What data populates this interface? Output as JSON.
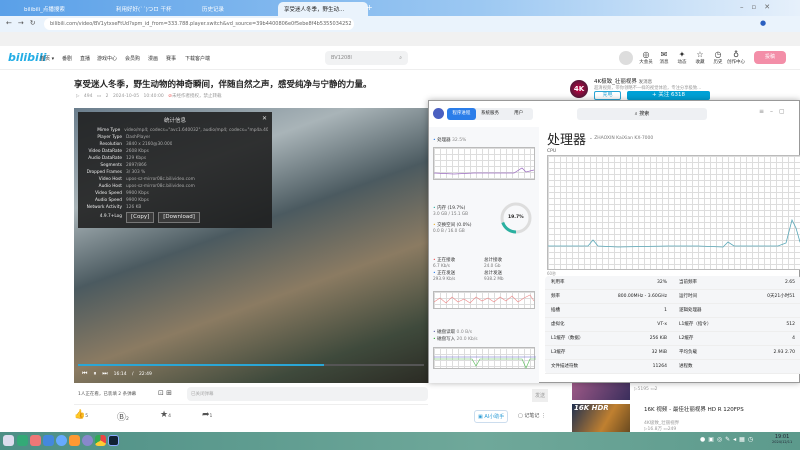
{
  "browser": {
    "tabs": [
      "bilibili_点播搜索",
      "利用好好(`´)つロ 干杯",
      "历史记录",
      "享受迷人冬季，野生动..."
    ],
    "url": "bilibili.com/video/BV1ytxseFtUd?spm_id_from=333.788.player.switch&vd_source=39b4400806e0f5ebe8f4b5355034252"
  },
  "header": {
    "logo": "bilibili",
    "nav": [
      "首页 ▾",
      "番剧",
      "直播",
      "游戏中心",
      "会员购",
      "漫画",
      "赛事",
      "下载客户端"
    ],
    "search_placeholder": "BV1208I",
    "icons": [
      {
        "label": "大会员",
        "icon": "vip-icon"
      },
      {
        "label": "消息",
        "icon": "message-icon",
        "badge": "1"
      },
      {
        "label": "动态",
        "icon": "dynamic-icon"
      },
      {
        "label": "收藏",
        "icon": "star-icon"
      },
      {
        "label": "历史",
        "icon": "clock-icon"
      },
      {
        "label": "创作中心",
        "icon": "bulb-icon"
      }
    ],
    "upload": "投稿"
  },
  "video": {
    "title": "享受迷人冬季，野生动物的神奇瞬间，伴随自然之声，感受纯净与宁静的力量。",
    "views": "494",
    "danmaku": "2",
    "date": "2024-10-05 10:40:00",
    "copyright": "未经作者授权，禁止转载",
    "time": "16:14 / 22:49",
    "progress": 0.71,
    "viewers": "1人正在看，已装填 2 条弹幕",
    "danmaku_placeholder": "已关闭弹幕",
    "send": "发送"
  },
  "stats_panel": {
    "title": "统计信息",
    "rows": [
      [
        "Mime Type",
        "video/mp4; codecs=\"avc1.640032\", audio/mp4; codecs=\"mp4a.40.2\""
      ],
      [
        "Player Type",
        "DashPlayer"
      ],
      [
        "Resolution",
        "3840 x 2160@30.000"
      ],
      [
        "Video DataRate",
        "2608 Kbps"
      ],
      [
        "Audio DataRate",
        "129 Kbps"
      ],
      [
        "Segments",
        "2897/866"
      ],
      [
        "Dropped Frames",
        "3/ 303 %"
      ],
      [
        "Video Host",
        "upos-sz-mirror08c.bilivideo.com"
      ],
      [
        "Audio Host",
        "upos-sz-mirror08c.bilivideo.com"
      ],
      [
        "Video Speed",
        "9900 Kbps"
      ],
      [
        "Audio Speed",
        "9900 Kbps"
      ],
      [
        "Network Activity",
        "126 KB"
      ]
    ],
    "log_label": "4.9.7+Log",
    "copy": "[Copy]",
    "download": "[Download]"
  },
  "actions": {
    "like": "5",
    "coin": "2",
    "fav": "4",
    "share": "1",
    "ai": "AI小助手",
    "notes": "记笔记"
  },
  "uploader": {
    "name": "4K极致_壮丽视界",
    "msg": "发消息",
    "desc": "超清视频，带你领略不一样的视觉体验，专注分享极致...",
    "charge": "充电",
    "follow": "+ 关注 6318"
  },
  "recs": [
    {
      "views": "5195",
      "dm": "2"
    },
    {
      "title": "16K 视频 - 最佳壮丽视界 HD R 120FPS",
      "author": "4K极致_壮丽视界",
      "views": "16.8万",
      "dm": "249"
    }
  ],
  "taskmgr": {
    "tabs": [
      "程序进程",
      "系统服务",
      "用户"
    ],
    "search": "搜索",
    "title": "处理器",
    "model": "ZHAOXIN KaiXian KX-7000",
    "graph_label": "CPU",
    "graph_axis": "60秒",
    "cpu": {
      "label": "处理器",
      "value": "32.5%"
    },
    "mem": {
      "label": "内存 (19.7%)",
      "value": "3.0 GB / 15.1 GB",
      "swap_label": "交换空间 (0.0%)",
      "swap_value": "0.0 B / 16.0 GB",
      "ring": "19.7%",
      "fraction": 0.197
    },
    "net": {
      "recv": "正在接收",
      "recv_v": "6.7 Kb/s",
      "total_recv": "总计接收",
      "total_recv_v": "24.0 Gb",
      "send": "正在发送",
      "send_v": "293.9 Kb/s",
      "total_send": "总计发送",
      "total_send_v": "938.2 Mb"
    },
    "disk": {
      "read": "磁盘读取",
      "read_v": "0.0 B/s",
      "write": "磁盘写入",
      "write_v": "20.0 Kb/s"
    },
    "rows": [
      [
        "利用率",
        "32%",
        "当前频率",
        "2.65"
      ],
      [
        "频率",
        "800.00MHz - 3.60GHz",
        "运行时间",
        "0天21小时51"
      ],
      [
        "插槽",
        "1",
        "逻辑处理器",
        ""
      ],
      [
        "虚拟化",
        "VT-x",
        "L1缓存（指令）",
        "512"
      ],
      [
        "L1缓存（数据）",
        "256 KiB",
        "L2缓存",
        "4"
      ],
      [
        "L3缓存",
        "32 MiB",
        "平均负载",
        "2.93 2.70"
      ],
      [
        "文件描述符数",
        "11264",
        "进程数",
        ""
      ]
    ]
  },
  "clock": {
    "time": "19:01",
    "date": "2024/12/11"
  }
}
